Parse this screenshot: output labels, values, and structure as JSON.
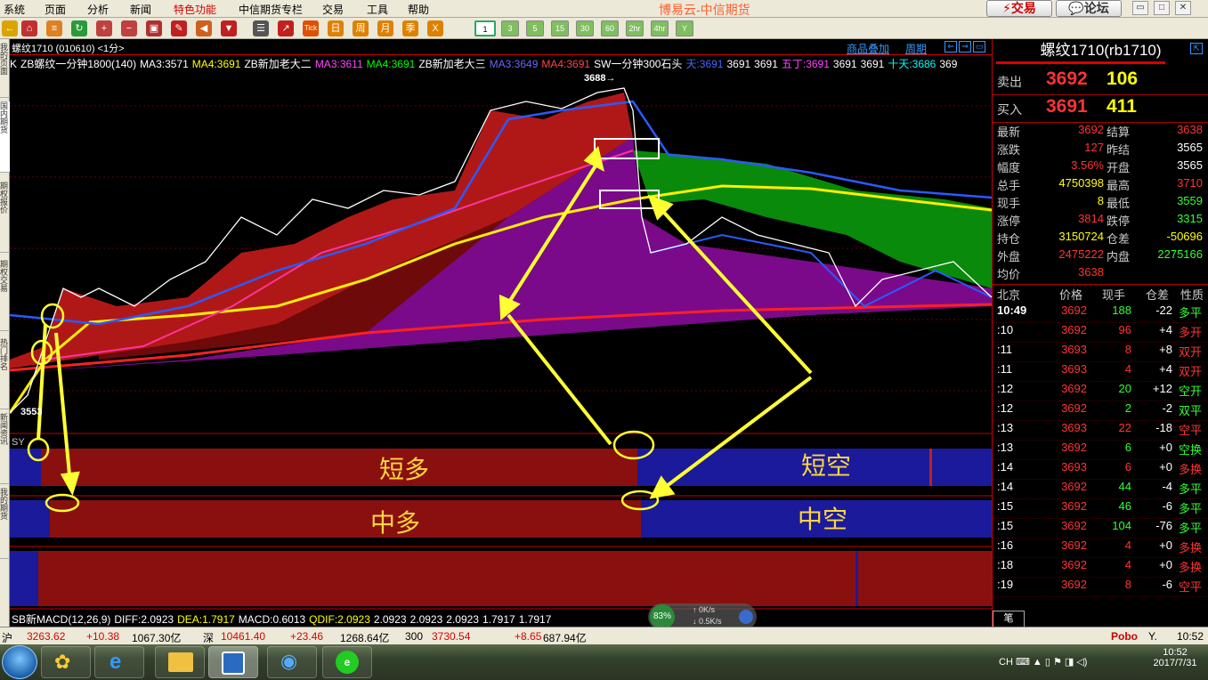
{
  "menu": [
    "系统",
    "页面",
    "分析",
    "新闻",
    "特色功能",
    "中信期货专栏",
    "交易",
    "工具",
    "帮助"
  ],
  "menu_active_index": 4,
  "app_title": "博易云-中信期货",
  "top_buttons": {
    "trade": "交易",
    "forum": "论坛"
  },
  "toolbar": {
    "icons": [
      "back-icon",
      "home-icon",
      "stack-icon",
      "refresh-icon",
      "zoom-in-icon",
      "zoom-out-icon",
      "window-icon",
      "pencil-icon",
      "speaker-icon",
      "funnel-icon",
      "list-icon",
      "chart-icon",
      "tick-icon",
      "day-icon",
      "week-icon",
      "month-icon",
      "season-icon",
      "year-icon"
    ],
    "tick_label": "Tick",
    "day_label": "日",
    "week_label": "周",
    "month_label": "月",
    "season_label": "季",
    "year_label": "X",
    "periods": [
      "1",
      "3",
      "5",
      "15",
      "30",
      "60",
      "2hr",
      "4hr",
      "Y"
    ],
    "selected_period": "1"
  },
  "left_tabs": [
    "我的页面",
    "国内期货",
    "期权报价",
    "期权交易",
    "热门排名",
    "新闻资讯",
    "我的期货"
  ],
  "chart": {
    "symbol_label": "螺纹1710 (010610) <1分>",
    "overlay_link": "商品叠加",
    "period_link": "周期",
    "ma_items": [
      {
        "text": "K",
        "color": "#ffffff"
      },
      {
        "text": "ZB螺纹一分钟1800(140)",
        "color": "#ffffff"
      },
      {
        "text": "MA3:3571",
        "color": "#ffffff"
      },
      {
        "text": "MA4:3691",
        "color": "#ffff00"
      },
      {
        "text": "ZB新加老大二",
        "color": "#ffffff"
      },
      {
        "text": "MA3:3611",
        "color": "#ff44ff"
      },
      {
        "text": "MA4:3691",
        "color": "#00ff00"
      },
      {
        "text": "ZB新加老大三",
        "color": "#ffffff"
      },
      {
        "text": "MA3:3649",
        "color": "#6666ff"
      },
      {
        "text": "MA4:3691",
        "color": "#ff4444"
      },
      {
        "text": "SW一分钟300石头",
        "color": "#ffffff"
      },
      {
        "text": "天:3691",
        "color": "#4466ff"
      },
      {
        "text": "3691",
        "color": "#ffffff"
      },
      {
        "text": "3691",
        "color": "#ffffff"
      },
      {
        "text": "五丁:3691",
        "color": "#ff44ff"
      },
      {
        "text": "3691",
        "color": "#ffffff"
      },
      {
        "text": "3691",
        "color": "#ffffff"
      },
      {
        "text": "十天:3686",
        "color": "#00ffff"
      },
      {
        "text": "369",
        "color": "#ffffff"
      }
    ],
    "peak_label": "3688→",
    "low_label": "3553",
    "sy_label": "SY",
    "band_labels": {
      "short_long": "短多",
      "short_short": "短空",
      "mid_long": "中多",
      "mid_short": "中空"
    },
    "indicator_items": [
      {
        "text": "SB新MACD(12,26,9)",
        "color": "#ffffff"
      },
      {
        "text": "DIFF:2.0923",
        "color": "#ffffff"
      },
      {
        "text": "DEA:1.7917",
        "color": "#ffff00"
      },
      {
        "text": "MACD:0.6013",
        "color": "#ffffff"
      },
      {
        "text": "QDIF:2.0923",
        "color": "#ffff00"
      },
      {
        "text": "2.0923",
        "color": "#ffffff"
      },
      {
        "text": "2.0923",
        "color": "#ffffff"
      },
      {
        "text": "2.0923",
        "color": "#ffffff"
      },
      {
        "text": "1.7917",
        "color": "#ffffff"
      },
      {
        "text": "1.7917",
        "color": "#ffffff"
      }
    ]
  },
  "quote": {
    "title": "螺纹1710(rb1710)",
    "sell": {
      "label": "卖出",
      "price": "3692",
      "vol": "106"
    },
    "buy": {
      "label": "买入",
      "price": "3691",
      "vol": "411"
    },
    "rows": [
      {
        "l1": "最新",
        "v1": "3692",
        "c1": "#ff3333",
        "l2": "结算",
        "v2": "3638",
        "c2": "#ff3333"
      },
      {
        "l1": "涨跌",
        "v1": "127",
        "c1": "#ff3333",
        "l2": "昨结",
        "v2": "3565",
        "c2": "#ffffff"
      },
      {
        "l1": "幅度",
        "v1": "3.56%",
        "c1": "#ff3333",
        "l2": "开盘",
        "v2": "3565",
        "c2": "#ffffff"
      },
      {
        "l1": "总手",
        "v1": "4750398",
        "c1": "#ffff00",
        "l2": "最高",
        "v2": "3710",
        "c2": "#ff3333"
      },
      {
        "l1": "现手",
        "v1": "8",
        "c1": "#ffff00",
        "l2": "最低",
        "v2": "3559",
        "c2": "#33ff33"
      },
      {
        "l1": "涨停",
        "v1": "3814",
        "c1": "#ff3333",
        "l2": "跌停",
        "v2": "3315",
        "c2": "#33ff33"
      },
      {
        "l1": "持仓",
        "v1": "3150724",
        "c1": "#ffff00",
        "l2": "仓差",
        "v2": "-50696",
        "c2": "#ffff00"
      },
      {
        "l1": "外盘",
        "v1": "2475222",
        "c1": "#ff3333",
        "l2": "内盘",
        "v2": "2275166",
        "c2": "#33ff33"
      },
      {
        "l1": "均价",
        "v1": "3638",
        "c1": "#ff3333",
        "l2": "",
        "v2": "",
        "c2": "#ffffff"
      }
    ],
    "tick_headers": [
      "北京",
      "价格",
      "现手",
      "仓差",
      "性质"
    ],
    "ticks": [
      {
        "t": "10:49",
        "p": "3692",
        "v": "188",
        "vc": "#33ff33",
        "d": "-22",
        "n": "多平",
        "nc": "#33ff33"
      },
      {
        "t": ":10",
        "p": "3692",
        "v": "96",
        "vc": "#ff3333",
        "d": "+4",
        "n": "多开",
        "nc": "#ff3333"
      },
      {
        "t": ":11",
        "p": "3693",
        "v": "8",
        "vc": "#ff3333",
        "d": "+8",
        "n": "双开",
        "nc": "#ff3333"
      },
      {
        "t": ":11",
        "p": "3693",
        "v": "4",
        "vc": "#ff3333",
        "d": "+4",
        "n": "双开",
        "nc": "#ff3333"
      },
      {
        "t": ":12",
        "p": "3692",
        "v": "20",
        "vc": "#33ff33",
        "d": "+12",
        "n": "空开",
        "nc": "#33ff33"
      },
      {
        "t": ":12",
        "p": "3692",
        "v": "2",
        "vc": "#33ff33",
        "d": "-2",
        "n": "双平",
        "nc": "#33ff33"
      },
      {
        "t": ":13",
        "p": "3693",
        "v": "22",
        "vc": "#ff3333",
        "d": "-18",
        "n": "空平",
        "nc": "#ff3333"
      },
      {
        "t": ":13",
        "p": "3692",
        "v": "6",
        "vc": "#33ff33",
        "d": "+0",
        "n": "空换",
        "nc": "#33ff33"
      },
      {
        "t": ":14",
        "p": "3693",
        "v": "6",
        "vc": "#ff3333",
        "d": "+0",
        "n": "多换",
        "nc": "#ff3333"
      },
      {
        "t": ":14",
        "p": "3692",
        "v": "44",
        "vc": "#33ff33",
        "d": "-4",
        "n": "多平",
        "nc": "#33ff33"
      },
      {
        "t": ":15",
        "p": "3692",
        "v": "46",
        "vc": "#33ff33",
        "d": "-6",
        "n": "多平",
        "nc": "#33ff33"
      },
      {
        "t": ":15",
        "p": "3692",
        "v": "104",
        "vc": "#33ff33",
        "d": "-76",
        "n": "多平",
        "nc": "#33ff33"
      },
      {
        "t": ":16",
        "p": "3692",
        "v": "4",
        "vc": "#ff3333",
        "d": "+0",
        "n": "多换",
        "nc": "#ff3333"
      },
      {
        "t": ":18",
        "p": "3692",
        "v": "4",
        "vc": "#ff3333",
        "d": "+0",
        "n": "多换",
        "nc": "#ff3333"
      },
      {
        "t": ":19",
        "p": "3692",
        "v": "8",
        "vc": "#ff3333",
        "d": "-6",
        "n": "空平",
        "nc": "#ff3333"
      }
    ],
    "panel_tab": "笔"
  },
  "status": {
    "sh_label": "沪",
    "sh_price": "3263.62",
    "sh_chg": "+10.38",
    "sh_amt": "1067.30亿",
    "sz_label": "深",
    "sz_price": "10461.40",
    "sz_chg": "+23.46",
    "sz_amt": "1268.64亿",
    "hs_label": "300",
    "hs_price": "3730.54",
    "hs_chg": "+8.65",
    "hs_amt": "687.94亿",
    "brand": "Pobo",
    "time": "10:52"
  },
  "net_widget": {
    "percent": "83%",
    "up": "0K/s",
    "down": "0.5K/s"
  },
  "taskbar": {
    "ime": "CH",
    "clock_time": "10:52",
    "clock_date": "2017/7/31"
  },
  "colors": {
    "up": "#ff3333",
    "down": "#33ff33",
    "menu_bg": "#ece9d8",
    "accent": "#d40000",
    "band_red": "#c02020",
    "band_blue": "#1a1a9a",
    "arrow": "#ffff33"
  }
}
